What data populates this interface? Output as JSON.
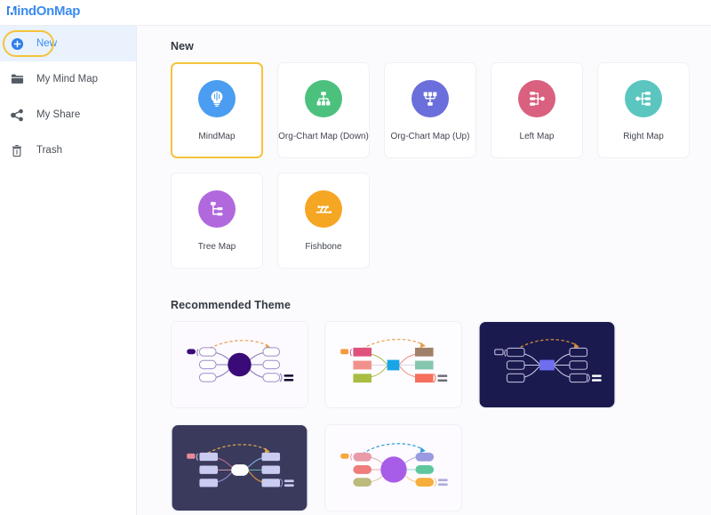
{
  "header": {
    "logo_text": "MindOnMap",
    "logo_m": "M",
    "logo_rest": "indOnMap",
    "brand_color": "#3b8cf0"
  },
  "sidebar": {
    "items": [
      {
        "label": "New",
        "icon": "plus-circle-icon",
        "active": true
      },
      {
        "label": "My Mind Map",
        "icon": "folder-icon",
        "active": false
      },
      {
        "label": "My Share",
        "icon": "share-icon",
        "active": false
      },
      {
        "label": "Trash",
        "icon": "trash-icon",
        "active": false
      }
    ],
    "highlight_color": "#f5c33b",
    "active_bg": "#e9f2fd"
  },
  "main": {
    "new_section_title": "New",
    "theme_section_title": "Recommended Theme",
    "map_types": [
      {
        "label": "MindMap",
        "icon": "lightbulb-icon",
        "color": "#4a9df0",
        "selected": true
      },
      {
        "label": "Org-Chart Map (Down)",
        "icon": "org-chart-down-icon",
        "color": "#4cc17e",
        "selected": false
      },
      {
        "label": "Org-Chart Map (Up)",
        "icon": "org-chart-up-icon",
        "color": "#6b6fdb",
        "selected": false
      },
      {
        "label": "Left Map",
        "icon": "left-map-icon",
        "color": "#d9607f",
        "selected": false
      },
      {
        "label": "Right Map",
        "icon": "right-map-icon",
        "color": "#5bc6c0",
        "selected": false
      },
      {
        "label": "Tree Map",
        "icon": "tree-map-icon",
        "color": "#b168dd",
        "selected": false
      },
      {
        "label": "Fishbone",
        "icon": "fishbone-icon",
        "color": "#f5a623",
        "selected": false
      }
    ],
    "themes": [
      {
        "name": "theme-purple-light",
        "bg": "#fcfaff",
        "center": "#3a0a78",
        "center_shape": "circle",
        "node_fill": "#ffffff",
        "node_stroke": "#9b8fc4",
        "line": "#8b7fbb",
        "arrow": "#e8a04a",
        "tag": "#3a0a78",
        "selected": false
      },
      {
        "name": "theme-colorful-light",
        "bg": "#fdfcff",
        "center": "#18a5e8",
        "center_shape": "rect",
        "node_fills": [
          "#e0527e",
          "#a08068",
          "#f2918c",
          "#85c7ae",
          "#a8bd42",
          "#f4705c"
        ],
        "node_stroke": "none",
        "line": "#d8d8e0",
        "arrow": "#e8a04a",
        "tag": "#f59a3c",
        "selected": false
      },
      {
        "name": "theme-dark-navy",
        "bg": "#1b1a4e",
        "center": "#6f6ef0",
        "center_shape": "rect",
        "node_fill": "#1b1a4e",
        "node_stroke": "#c9cce8",
        "line": "#c9cce8",
        "arrow": "#d08a3a",
        "tag": "#ffffff",
        "selected": true
      },
      {
        "name": "theme-dark-slate",
        "bg": "#393a5c",
        "center": "#ffffff",
        "center_shape": "rounded",
        "node_fill": "#c9cbf0",
        "node_stroke": "none",
        "line": "#b0a0c8",
        "arrow": "#d6a84a",
        "tag": "#e88a9a",
        "selected": false
      },
      {
        "name": "theme-violet-light",
        "bg": "#fdfbff",
        "center": "#a85de8",
        "center_shape": "circle",
        "node_fills": [
          "#e89aa8",
          "#ef7d7d",
          "#bcba7c",
          "#9a9ae0",
          "#5fc79e",
          "#f5ad3c"
        ],
        "node_stroke": "none",
        "line": "#e0d8e8",
        "arrow": "#3aa0d8",
        "tag": "#f5a83c",
        "selected": false
      }
    ]
  }
}
